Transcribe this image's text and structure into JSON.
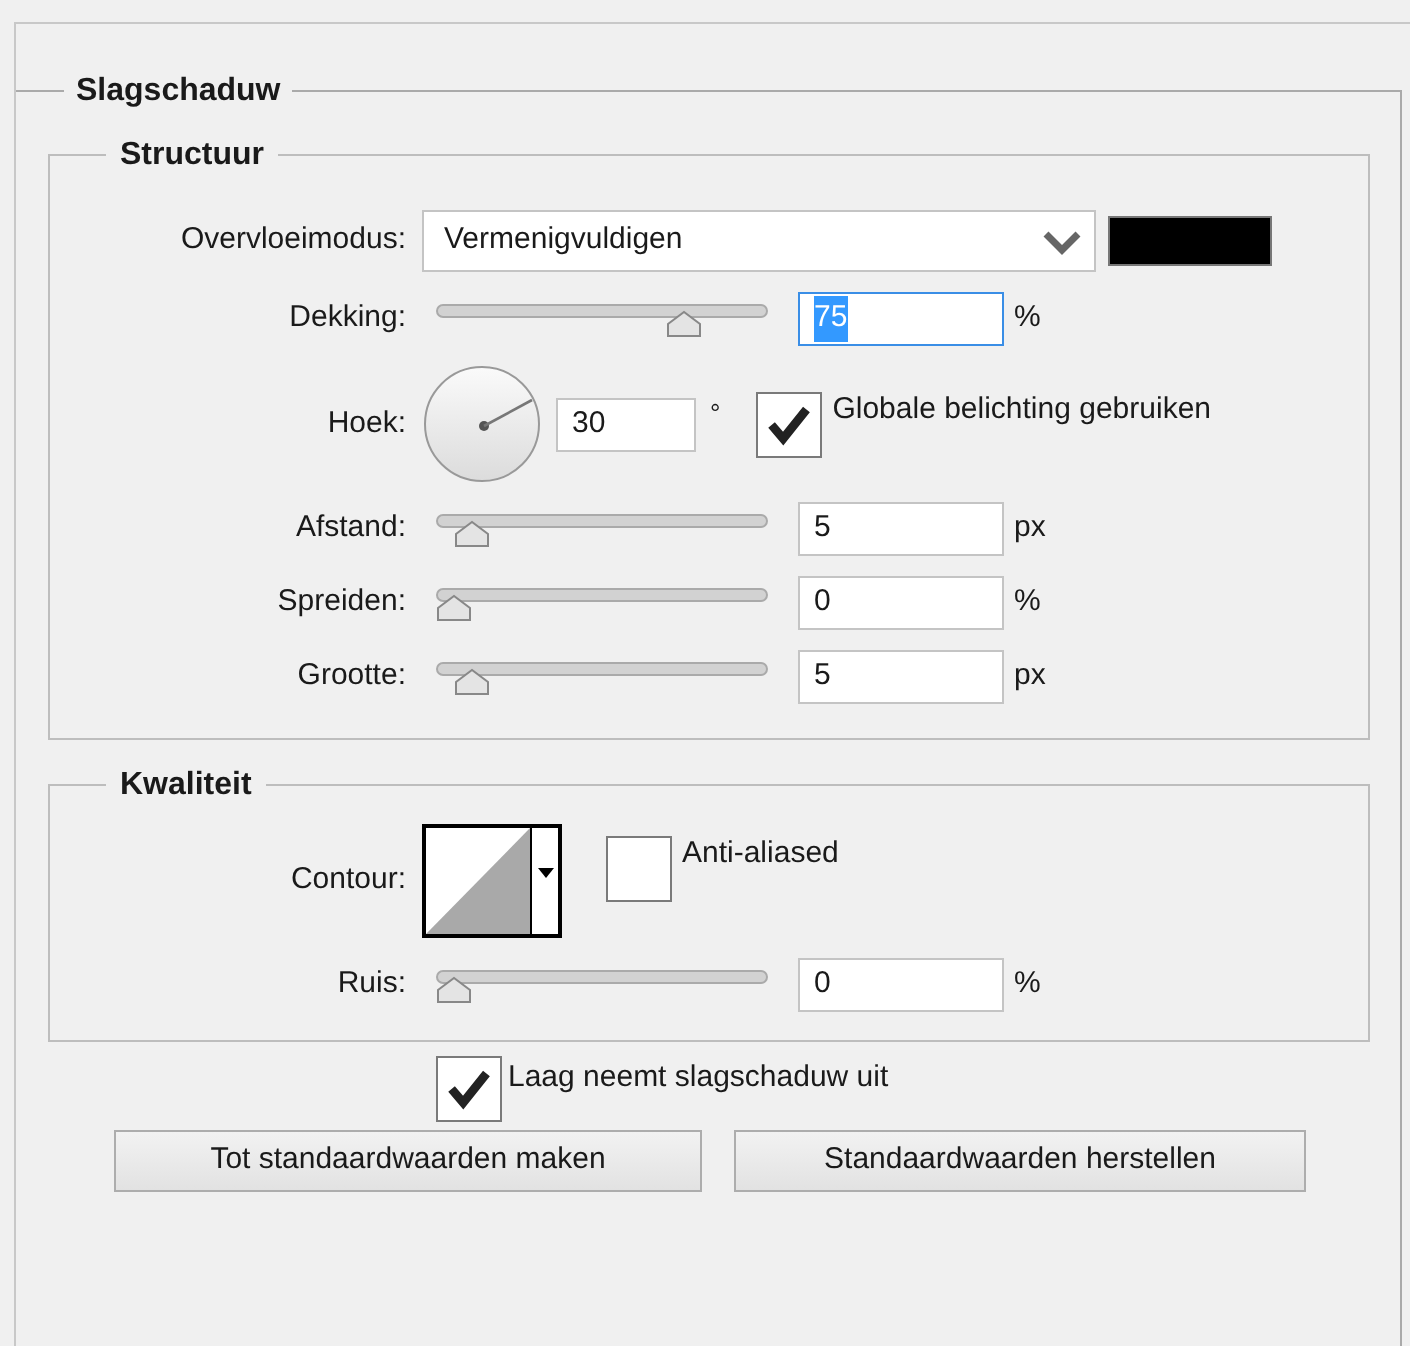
{
  "panel": {
    "title": "Slagschaduw",
    "sections": [
      {
        "title": "Structuur",
        "rows": [
          {
            "kind": "select",
            "label": "Overvloeimodus:",
            "value": "Vermenigvuldigen",
            "color": "#000000"
          },
          {
            "kind": "slider",
            "label": "Dekking:",
            "level": 0.78,
            "value": "75",
            "highlighted": true,
            "unit": "%"
          },
          {
            "kind": "angle",
            "label": "Hoek:",
            "value": "30",
            "unit": "°",
            "checkbox": {
              "label": "Globale belichting gebruiken",
              "checked": true
            }
          },
          {
            "kind": "slider",
            "label": "Afstand:",
            "level": 0.06,
            "value": "5",
            "highlighted": false,
            "unit": "px"
          },
          {
            "kind": "slider",
            "label": "Spreiden:",
            "level": 0,
            "value": "0",
            "highlighted": false,
            "unit": "%"
          },
          {
            "kind": "slider",
            "label": "Grootte:",
            "level": 0.06,
            "value": "5",
            "highlighted": false,
            "unit": "px"
          }
        ]
      },
      {
        "title": "Kwaliteit",
        "rows": [
          {
            "kind": "contour",
            "label": "Contour:",
            "checkbox": {
              "label": "Anti-aliased",
              "checked": false
            }
          },
          {
            "kind": "slider",
            "label": "Ruis:",
            "level": 0,
            "value": "0",
            "highlighted": false,
            "unit": "%"
          }
        ]
      }
    ],
    "knockout": {
      "label": "Laag neemt slagschaduw uit",
      "checked": true
    },
    "buttons": [
      "Tot standaardwaarden maken",
      "Standaardwaarden herstellen"
    ]
  }
}
